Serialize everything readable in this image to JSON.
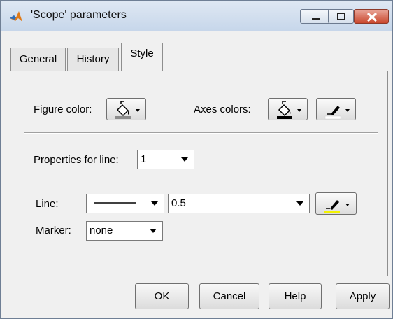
{
  "window": {
    "title": "'Scope' parameters",
    "icon": "matlab-logo-icon",
    "controls": [
      "minimize-icon",
      "maximize-icon",
      "close-icon"
    ]
  },
  "tabs": [
    {
      "label": "General",
      "selected": false
    },
    {
      "label": "History",
      "selected": false
    },
    {
      "label": "Style",
      "selected": true
    }
  ],
  "style_tab": {
    "figure_color_label": "Figure color:",
    "axes_colors_label": "Axes colors:",
    "properties_for_line_label": "Properties for line:",
    "properties_for_line_value": "1",
    "line_label": "Line:",
    "line_width_value": "0.5",
    "line_color": "#f2f200",
    "marker_label": "Marker:",
    "marker_value": "none"
  },
  "buttons": {
    "ok": "OK",
    "cancel": "Cancel",
    "help": "Help",
    "apply": "Apply"
  }
}
